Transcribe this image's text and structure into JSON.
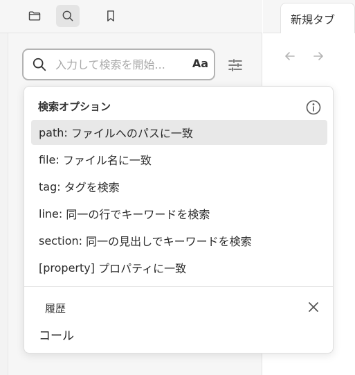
{
  "toolbar": {
    "icons": [
      "folder-icon",
      "search-icon",
      "bookmark-icon"
    ],
    "active": "search"
  },
  "search": {
    "value": "",
    "placeholder": "入力して検索を開始...",
    "match_case_label": "Aa"
  },
  "search_options": {
    "title": "検索オプション",
    "items": [
      {
        "key": "path:",
        "desc": "ファイルへのパスに一致",
        "highlighted": true
      },
      {
        "key": "file:",
        "desc": "ファイル名に一致"
      },
      {
        "key": "tag:",
        "desc": "タグを検索"
      },
      {
        "key": "line:",
        "desc": "同一の行でキーワードを検索"
      },
      {
        "key": "section:",
        "desc": "同一の見出しでキーワードを検索"
      },
      {
        "key": "[property]",
        "desc": "プロパティに一致"
      }
    ]
  },
  "history": {
    "title": "履歴",
    "items": [
      "コール"
    ]
  },
  "tab": {
    "label": "新規タブ"
  },
  "colors": {
    "sidebar_bg": "#f6f6f6",
    "highlight_bg": "#e8e8e8",
    "border": "#b3b3b3"
  }
}
